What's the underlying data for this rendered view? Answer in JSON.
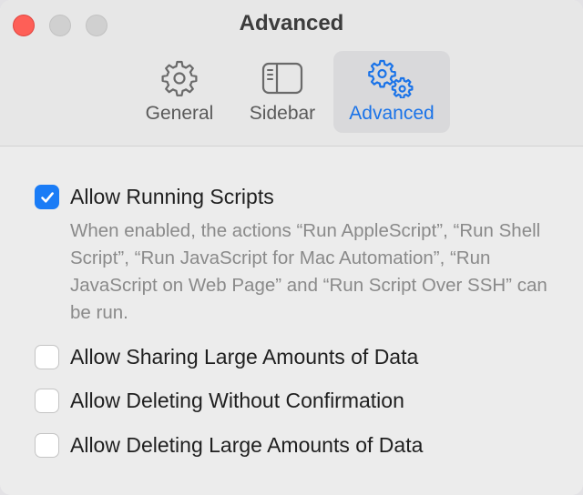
{
  "window": {
    "title": "Advanced"
  },
  "toolbar": {
    "tabs": [
      {
        "label": "General",
        "icon": "gear-icon",
        "selected": false
      },
      {
        "label": "Sidebar",
        "icon": "sidebar-icon",
        "selected": false
      },
      {
        "label": "Advanced",
        "icon": "gears-icon",
        "selected": true
      }
    ]
  },
  "options": [
    {
      "label": "Allow Running Scripts",
      "checked": true,
      "description": "When enabled, the actions “Run AppleScript”, “Run Shell Script”, “Run JavaScript for Mac Automation”, “Run JavaScript on Web Page” and “Run Script Over SSH” can be run."
    },
    {
      "label": "Allow Sharing Large Amounts of Data",
      "checked": false
    },
    {
      "label": "Allow Deleting Without Confirmation",
      "checked": false
    },
    {
      "label": "Allow Deleting Large Amounts of Data",
      "checked": false
    }
  ],
  "colors": {
    "accent": "#1a7cf6",
    "close": "#fe5f57"
  }
}
